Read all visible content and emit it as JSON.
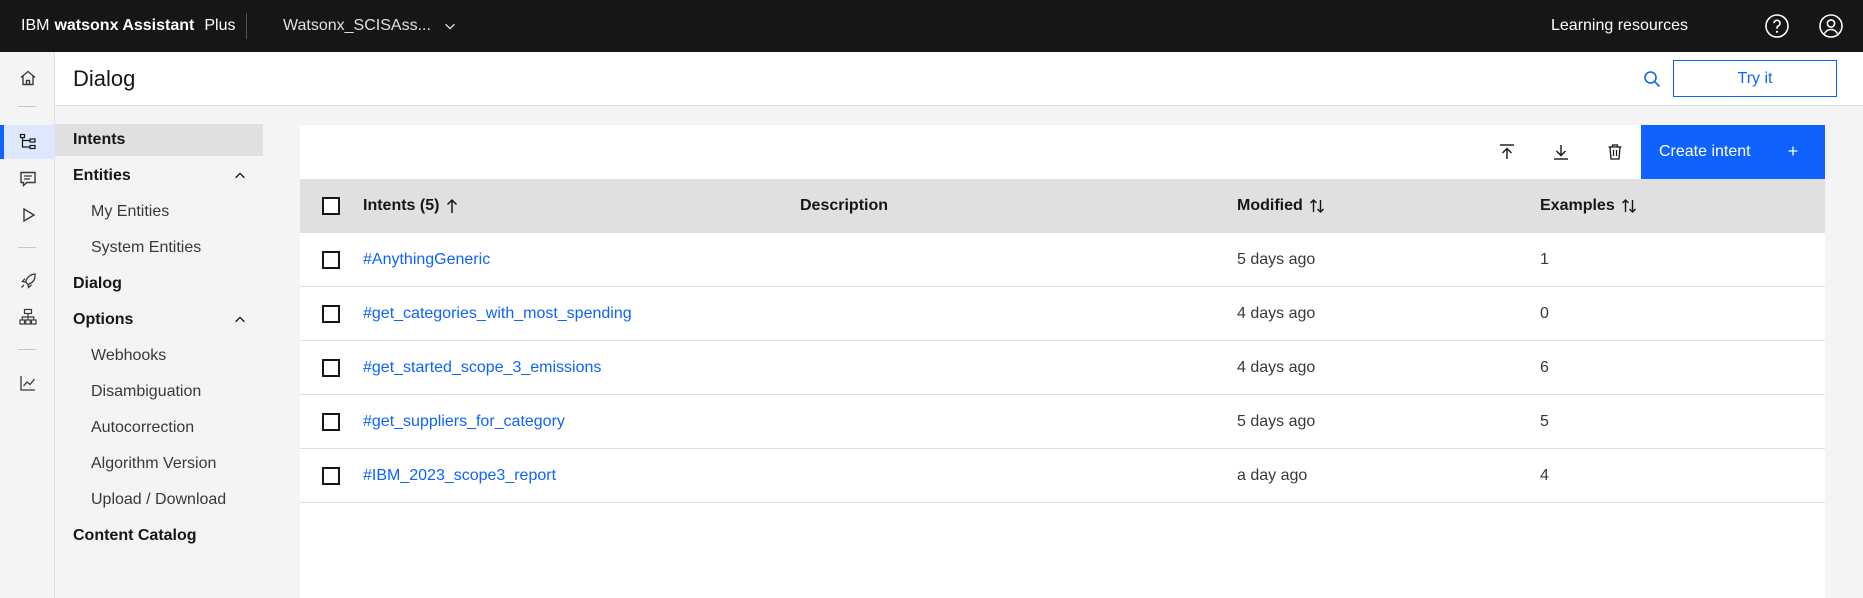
{
  "header": {
    "ibm": "IBM",
    "product": "watsonx Assistant",
    "plan": "Plus",
    "assistant_name": "Watsonx_SCISAss...",
    "learning_resources": "Learning resources"
  },
  "page": {
    "title": "Dialog",
    "try_it": "Try it"
  },
  "rail": {
    "icons": [
      "home-icon",
      "dialog-tree-icon",
      "chat-preview-icon",
      "play-icon",
      "rocket-icon",
      "integrations-icon",
      "analytics-icon"
    ],
    "active": "dialog-tree-icon"
  },
  "nav": {
    "intents": "Intents",
    "entities": "Entities",
    "my_entities": "My Entities",
    "system_entities": "System Entities",
    "dialog": "Dialog",
    "options": "Options",
    "webhooks": "Webhooks",
    "disambiguation": "Disambiguation",
    "autocorrection": "Autocorrection",
    "algorithm_version": "Algorithm Version",
    "upload_download": "Upload / Download",
    "content_catalog": "Content Catalog"
  },
  "toolbar": {
    "upload_icon": "upload-icon",
    "download_icon": "download-icon",
    "delete_icon": "trash-icon",
    "create_label": "Create intent"
  },
  "table": {
    "headers": {
      "intents": "Intents (5)",
      "description": "Description",
      "modified": "Modified",
      "examples": "Examples"
    },
    "rows": [
      {
        "name": "#AnythingGeneric",
        "description": "",
        "modified": "5 days ago",
        "examples": "1"
      },
      {
        "name": "#get_categories_with_most_spending",
        "description": "",
        "modified": "4 days ago",
        "examples": "0"
      },
      {
        "name": "#get_started_scope_3_emissions",
        "description": "",
        "modified": "4 days ago",
        "examples": "6"
      },
      {
        "name": "#get_suppliers_for_category",
        "description": "",
        "modified": "5 days ago",
        "examples": "5"
      },
      {
        "name": "#IBM_2023_scope3_report",
        "description": "",
        "modified": "a day ago",
        "examples": "4"
      }
    ]
  },
  "colors": {
    "accent": "#0f62fe",
    "topbar": "#161616",
    "header_row": "#e0e0e0"
  }
}
